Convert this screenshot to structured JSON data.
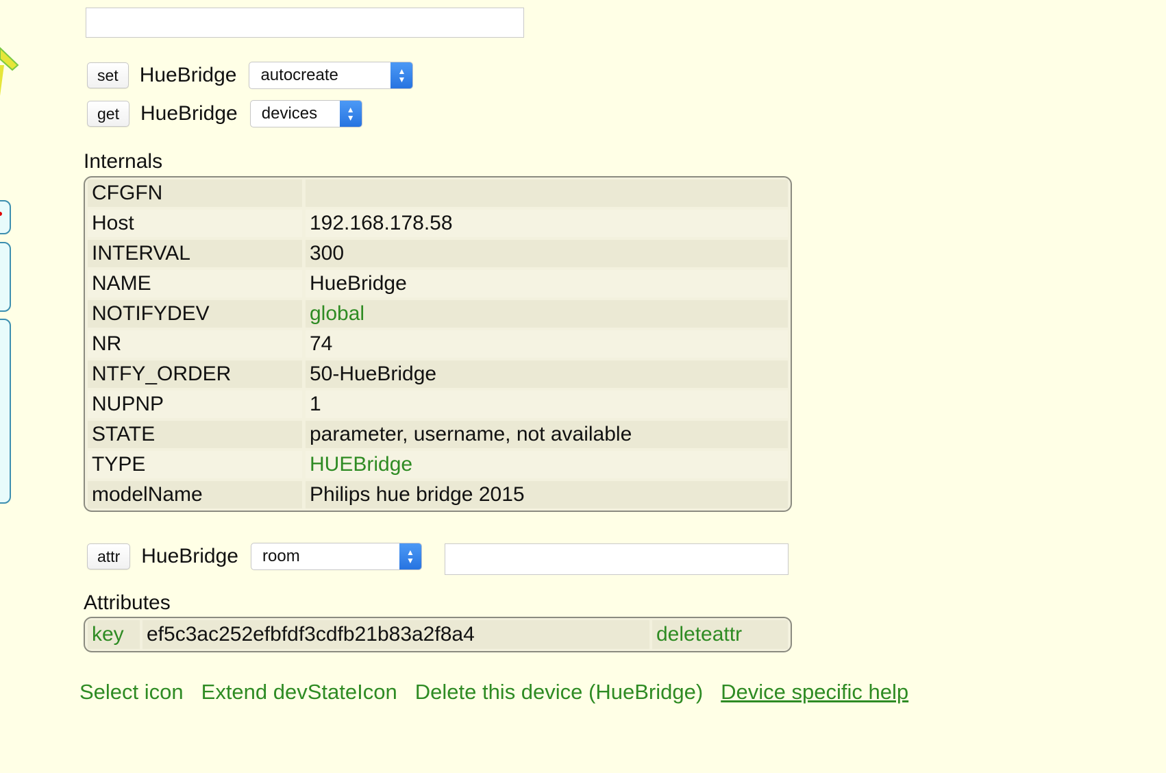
{
  "commands": {
    "set": {
      "button": "set",
      "device": "HueBridge",
      "selected": "autocreate"
    },
    "get": {
      "button": "get",
      "device": "HueBridge",
      "selected": "devices"
    },
    "attr": {
      "button": "attr",
      "device": "HueBridge",
      "selected": "room"
    }
  },
  "internals": {
    "title": "Internals",
    "rows": [
      {
        "key": "CFGFN",
        "value": ""
      },
      {
        "key": "Host",
        "value": "192.168.178.58"
      },
      {
        "key": "INTERVAL",
        "value": "300"
      },
      {
        "key": "NAME",
        "value": "HueBridge"
      },
      {
        "key": "NOTIFYDEV",
        "value": "global"
      },
      {
        "key": "NR",
        "value": "74"
      },
      {
        "key": "NTFY_ORDER",
        "value": "50-HueBridge"
      },
      {
        "key": "NUPNP",
        "value": "1"
      },
      {
        "key": "STATE",
        "value": "parameter, username, not available"
      },
      {
        "key": "TYPE",
        "value": "HUEBridge"
      },
      {
        "key": "modelName",
        "value": "Philips hue bridge 2015"
      }
    ]
  },
  "attributes": {
    "title": "Attributes",
    "rows": [
      {
        "key": "key",
        "value": "ef5c3ac252efbfdf3cdfb21b83a2f8a4",
        "action": "deleteattr"
      }
    ]
  },
  "footer": {
    "select_icon": "Select icon",
    "extend_icon": "Extend devStateIcon",
    "delete_device": "Delete this device (HueBridge)",
    "help": "Device specific help"
  },
  "colors": {
    "background": "#ffffe6",
    "link_green": "#2e8b23",
    "select_arrow": "#2673e0"
  }
}
